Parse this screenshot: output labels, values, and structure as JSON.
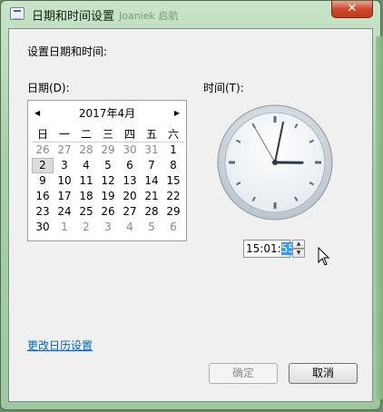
{
  "window": {
    "title": "日期和时间设置",
    "background_title": "Joaniek 启航",
    "close_glyph": "✕"
  },
  "dialog": {
    "heading": "设置日期和时间:",
    "date_label": "日期(D):",
    "time_label": "时间(T):",
    "change_calendar_link": "更改日历设置",
    "ok_label": "确定",
    "cancel_label": "取消"
  },
  "calendar": {
    "title": "2017年4月",
    "prev_glyph": "◀",
    "next_glyph": "▶",
    "weekdays": [
      "日",
      "一",
      "二",
      "三",
      "四",
      "五",
      "六"
    ],
    "days": [
      [
        "26",
        "27",
        "28",
        "29",
        "30",
        "31",
        "1"
      ],
      [
        "2",
        "3",
        "4",
        "5",
        "6",
        "7",
        "8"
      ],
      [
        "9",
        "10",
        "11",
        "12",
        "13",
        "14",
        "15"
      ],
      [
        "16",
        "17",
        "18",
        "19",
        "20",
        "21",
        "22"
      ],
      [
        "23",
        "24",
        "25",
        "26",
        "27",
        "28",
        "29"
      ],
      [
        "30",
        "1",
        "2",
        "3",
        "4",
        "5",
        "6"
      ]
    ],
    "selected_day": "2"
  },
  "time": {
    "hour": 15,
    "minute": 1,
    "second": 55,
    "display_prefix": "15:01:",
    "display_seconds": "55"
  },
  "icons": {
    "up_glyph": "▲",
    "down_glyph": "▼"
  }
}
